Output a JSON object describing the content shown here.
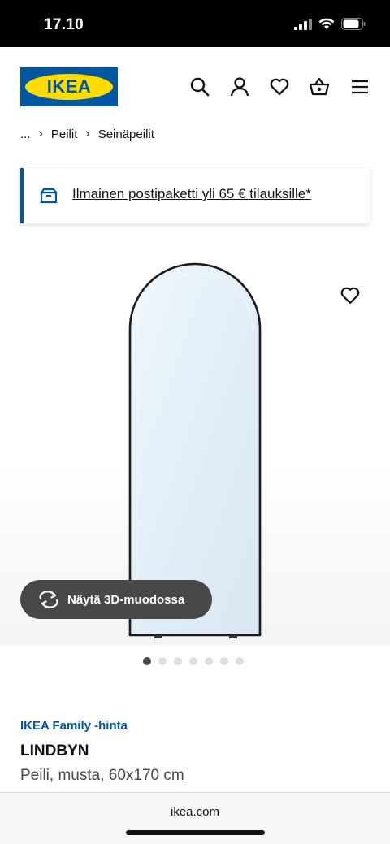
{
  "status_bar": {
    "time": "17.10"
  },
  "header": {
    "logo_text": "IKEA"
  },
  "breadcrumb": {
    "ellipsis": "...",
    "items": [
      "Peilit",
      "Seinäpeilit"
    ]
  },
  "banner": {
    "text": "Ilmainen postipaketti yli 65 € tilauksille*"
  },
  "gallery": {
    "view_3d_label": "Näytä 3D-muodossa",
    "image_count": 7,
    "active_index": 0
  },
  "product": {
    "family_price_label": "IKEA Family -hinta",
    "name": "LINDBYN",
    "description": "Peili, musta,",
    "size": "60x170 cm"
  },
  "browser": {
    "url": "ikea.com"
  },
  "colors": {
    "brand_blue": "#0058a3",
    "brand_yellow": "#ffdb00",
    "button_dark": "#484848"
  }
}
